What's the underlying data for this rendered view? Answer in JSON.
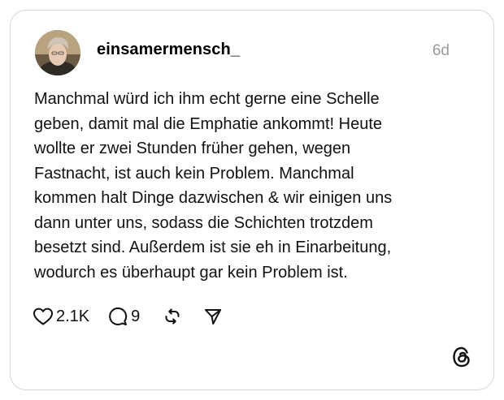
{
  "post": {
    "username": "einsamermensch_",
    "time_ago": "6d",
    "text_lines": [
      "Manchmal würd ich ihm echt gerne eine Schelle",
      "geben, damit mal die Emphatie ankommt! Heute",
      "wollte er zwei Stunden früher gehen, wegen",
      "Fastnacht, ist auch kein Problem. Manchmal",
      "kommen halt Dinge dazwischen & wir einigen uns",
      "dann unter uns, sodass die Schichten trotzdem",
      "besetzt sind. Außerdem ist sie eh in Einarbeitung,",
      "wodurch es überhaupt gar kein Problem ist."
    ]
  },
  "actions": {
    "like_count": "2.1K",
    "reply_count": "9",
    "icons": [
      "heart-icon",
      "comment-icon",
      "repost-icon",
      "share-icon"
    ]
  },
  "branding": {
    "logo_icon": "threads-logo-icon"
  },
  "colors": {
    "border": "#d6d6d6",
    "timestamp": "#9a9a9a",
    "text": "#111111"
  }
}
